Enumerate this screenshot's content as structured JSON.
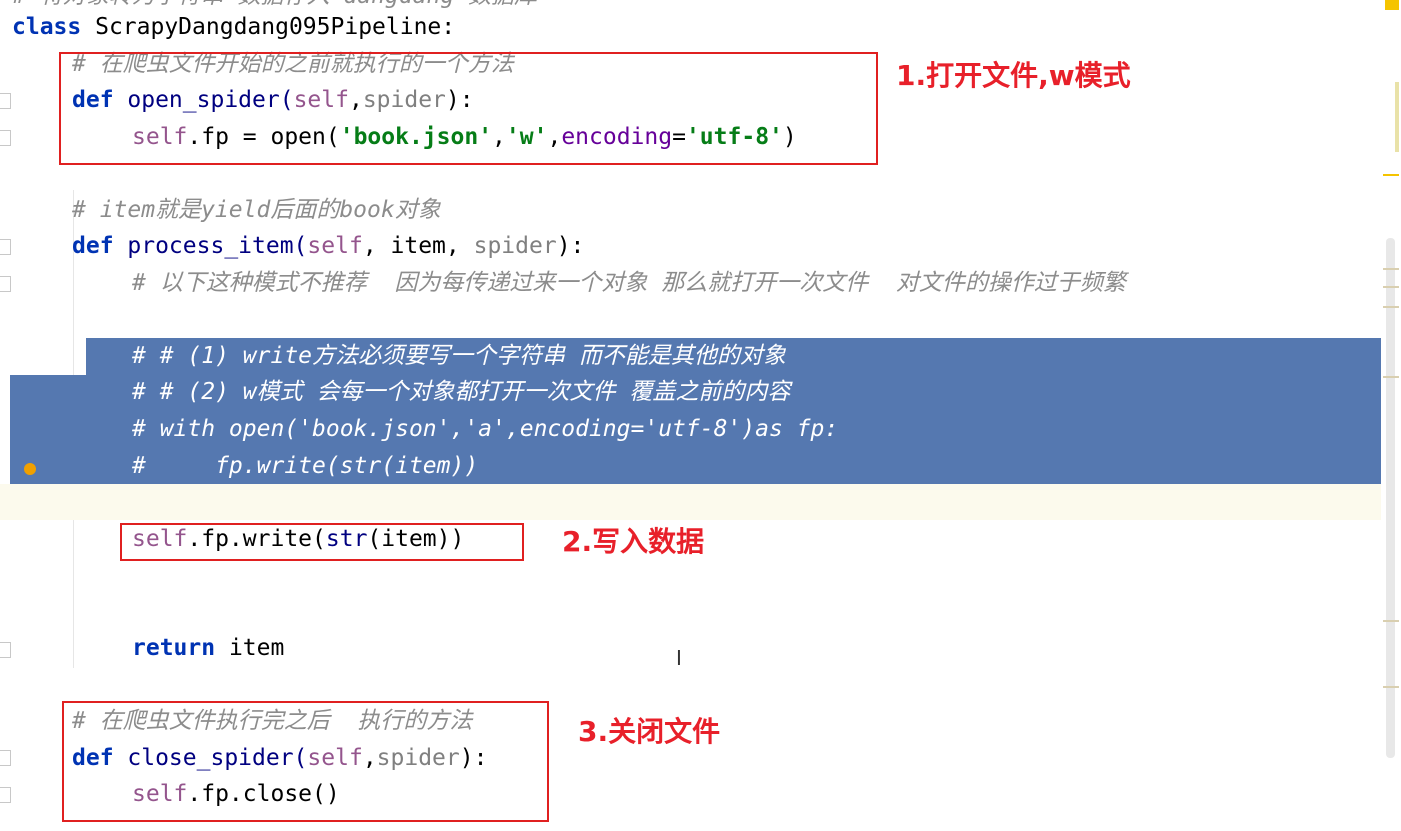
{
  "code": {
    "top_partial": "# 将对象转为字符串 数据存入 dangdang 数据库",
    "class_kw": "class",
    "class_name": " ScrapyDangdang095Pipeline:",
    "c1": "# 在爬虫文件开始的之前就执行的一个方法",
    "l_open_def": "def",
    "l_open_name": " open_spider(",
    "l_open_self": "self",
    "l_open_comma": ",",
    "l_open_spider": "spider",
    "l_open_end": "):",
    "l_fp_self": "self",
    "l_fp_mid": ".fp = open(",
    "l_fp_s1": "'book.json'",
    "l_fp_c1": ",",
    "l_fp_s2": "'w'",
    "l_fp_c2": ",",
    "l_fp_enc": "encoding",
    "l_fp_eq": "=",
    "l_fp_s3": "'utf-8'",
    "l_fp_end": ")",
    "c2": "# item就是yield后面的book对象",
    "l_proc_def": "def",
    "l_proc_name": " process_item(",
    "l_proc_self": "self",
    "l_proc_mid": ", item, ",
    "l_proc_spider": "spider",
    "l_proc_end": "):",
    "c3": "# 以下这种模式不推荐  因为每传递过来一个对象 那么就打开一次文件  对文件的操作过于频繁",
    "s1": "# # (1) write方法必须要写一个字符串 而不能是其他的对象",
    "s2": "# # (2) w模式 会每一个对象都打开一次文件 覆盖之前的内容",
    "s3": "# with open('book.json','a',encoding='utf-8')as fp:",
    "s4": "#     fp.write(str(item))",
    "l_write_self": "self",
    "l_write_rest": ".fp.write(",
    "l_write_str": "str",
    "l_write_end": "(item))",
    "l_ret_kw": "return",
    "l_ret_rest": " item",
    "c4": "# 在爬虫文件执行完之后  执行的方法",
    "l_close_def": "def",
    "l_close_name": " close_spider(",
    "l_close_self": "self",
    "l_close_comma": ",",
    "l_close_spider": "spider",
    "l_close_end": "):",
    "l_fc_self": "self",
    "l_fc_rest": ".fp.close()"
  },
  "annotations": {
    "note1": "1.打开文件,w模式",
    "note2": "2.写入数据",
    "note3": "3.关闭文件"
  },
  "colors": {
    "selection": "#5578b0",
    "annotation": "#e02020",
    "keyword": "#0033b3",
    "string": "#067d17",
    "comment": "#8c8c8c"
  }
}
